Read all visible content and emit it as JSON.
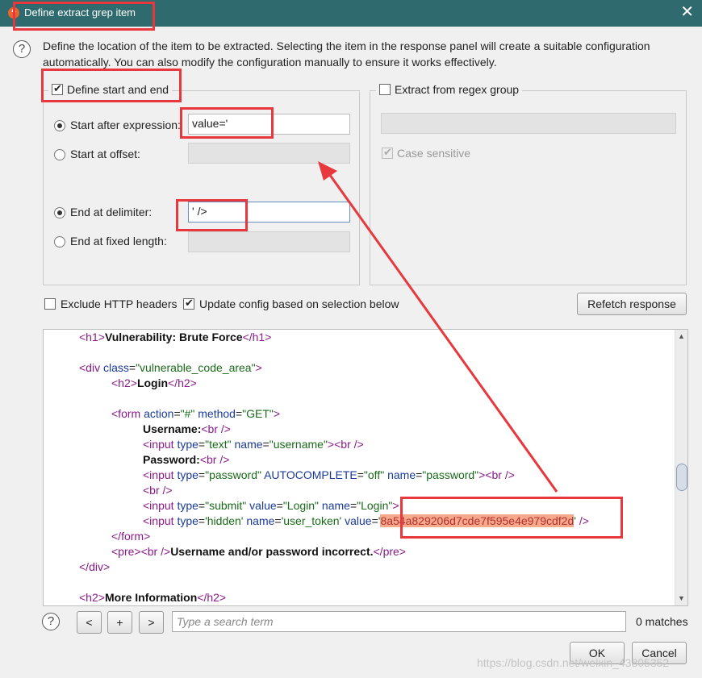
{
  "window": {
    "title": "Define extract grep item",
    "close_glyph": "✕",
    "app_icon": "burp-icon"
  },
  "description": "Define the location of the item to be extracted. Selecting the item in the response panel will create a suitable configuration automatically. You can also modify the configuration manually to ensure it works effectively.",
  "start_end_group": {
    "legend": "Define start and end",
    "checked": true,
    "start_after_label": "Start after expression:",
    "start_after_value": "value='",
    "start_offset_label": "Start at offset:",
    "end_delim_label": "End at delimiter:",
    "end_delim_value": "' />",
    "end_fixed_label": "End at fixed length:"
  },
  "regex_group": {
    "legend": "Extract from regex group",
    "checked": false,
    "case_sensitive_label": "Case sensitive"
  },
  "options": {
    "exclude_headers_label": "Exclude HTTP headers",
    "update_config_label": "Update config based on selection below",
    "refetch_label": "Refetch response"
  },
  "code_lines": {
    "l1_text": "Vulnerability: Brute Force",
    "l3_class": "\"vulnerable_code_area\"",
    "l4_text": "Login",
    "l6_action": "\"#\"",
    "l6_method": "\"GET\"",
    "l7_text": "Username:",
    "l8_type": "\"text\"",
    "l8_name": "\"username\"",
    "l9_text": "Password:",
    "l10_type": "\"password\"",
    "l10_auto": "\"off\"",
    "l10_name": "\"password\"",
    "l12_type": "\"submit\"",
    "l12_value": "\"Login\"",
    "l12_name": "\"Login\"",
    "l13_type": "'hidden'",
    "l13_name": "'user_token'",
    "l13_value": "8a54a829206d7cde7f595e4e979cdf2d",
    "l15_text": "Username and/or password incorrect.",
    "l18_text": "More Information"
  },
  "search": {
    "prev": "<",
    "add": "+",
    "next": ">",
    "placeholder": "Type a search term",
    "matches": "0 matches"
  },
  "footer": {
    "ok": "OK",
    "cancel": "Cancel",
    "watermark": "https://blog.csdn.net/weixin_43805352"
  },
  "colors": {
    "titlebar": "#2f6b6e",
    "annotation_red": "#e8383d",
    "highlight": "#f7a98c"
  }
}
